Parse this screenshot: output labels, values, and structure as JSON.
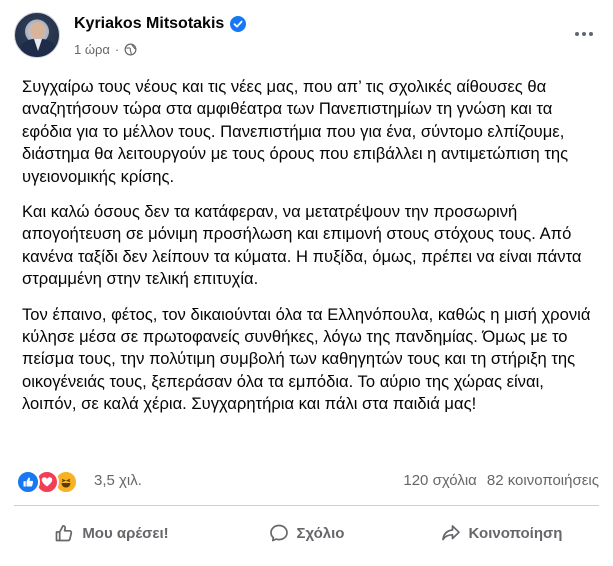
{
  "post": {
    "author": "Kyriakos Mitsotakis",
    "time": "1 ώρα",
    "separator": "·",
    "paragraphs": [
      "Συγχαίρω τους νέους και τις νέες μας, που απ’ τις σχολικές αίθουσες θα αναζητήσουν τώρα στα αμφιθέατρα των Πανεπιστημίων τη γνώση και τα εφόδια για το μέλλον τους. Πανεπιστήμια που για ένα, σύντομο ελπίζουμε, διάστημα θα λειτουργούν με τους όρους που επιβάλλει η αντιμετώπιση της υγειονομικής κρίσης.",
      "Και καλώ όσους δεν τα κατάφεραν, να μετατρέψουν την προσωρινή απογοήτευση σε μόνιμη προσήλωση και επιμονή στους στόχους τους. Από κανένα ταξίδι δεν λείπουν τα κύματα. Η πυξίδα, όμως, πρέπει να είναι πάντα στραμμένη στην τελική επιτυχία.",
      "Τον έπαινο, φέτος, τον δικαιούνται όλα τα Ελληνόπουλα, καθώς η μισή χρονιά κύλησε μέσα σε πρωτοφανείς συνθήκες, λόγω της πανδημίας. Όμως με το πείσμα τους, την πολύτιμη συμβολή των καθηγητών τους και τη στήριξη της οικογένειάς τους, ξεπεράσαν όλα τα εμπόδια. Το αύριο της χώρας είναι, λοιπόν, σε καλά χέρια. Συγχαρητήρια και πάλι στα παιδιά μας!"
    ]
  },
  "engagement": {
    "reactions_count": "3,5 χιλ.",
    "comments": "120 σχόλια",
    "shares": "82 κοινοποιήσεις",
    "reaction_icons": [
      "like-icon",
      "love-icon",
      "haha-icon"
    ]
  },
  "actions": {
    "like": "Μου αρέσει!",
    "comment": "Σχόλιο",
    "share": "Κοινοποίηση"
  },
  "colors": {
    "facebook_blue": "#1877f2",
    "love_red": "#f33e58",
    "haha_yellow": "#f7b125",
    "secondary_text": "#65676b"
  }
}
